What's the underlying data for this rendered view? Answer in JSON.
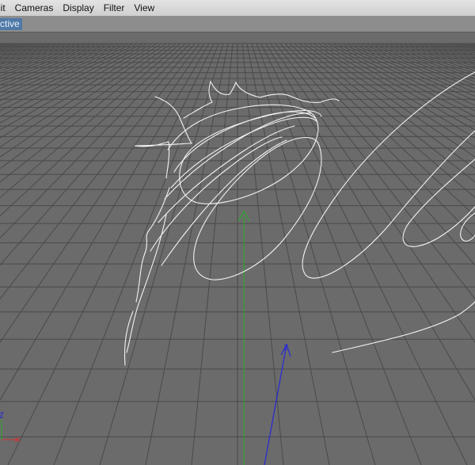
{
  "menubar": {
    "items": [
      {
        "label": "lit",
        "name": "menu-edit"
      },
      {
        "label": "Cameras",
        "name": "menu-cameras"
      },
      {
        "label": "Display",
        "name": "menu-display"
      },
      {
        "label": "Filter",
        "name": "menu-filter"
      },
      {
        "label": "View",
        "name": "menu-view"
      }
    ]
  },
  "viewport": {
    "label": "ctive",
    "axis_z_label": "Z",
    "colors": {
      "background": "#6b6b6b",
      "grid": "#4a4a4a",
      "spline": "#f2f2f2",
      "y_axis": "#2ea82e",
      "z_axis": "#2c2ccf",
      "x_axis": "#d03030"
    }
  }
}
